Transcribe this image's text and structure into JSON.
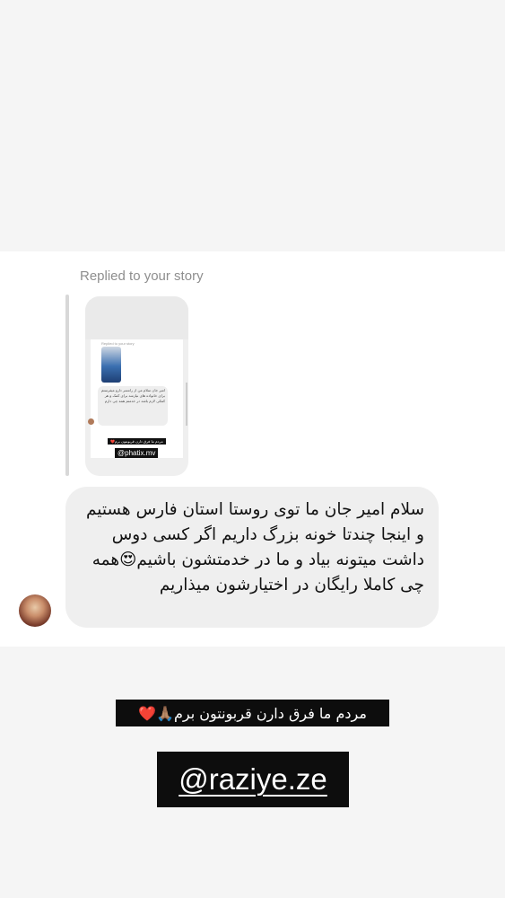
{
  "story_reply": {
    "label": "Replied to your story",
    "thumbnail": {
      "mini_label": "Replied to your story",
      "mini_message": "امیر جان سلام من از رامسر دارو میفرستم برای خانواده های نیازمند برای کمک و هر کمکی لازم باشد در خدمتم همه چی دارم",
      "mini_sticker_caption": "مردم ما فرق دارن قربونتون برم❤️",
      "mini_mention": "@phatix.mv"
    }
  },
  "message": {
    "text": "سلام امیر جان ما توی روستا استان فارس هستیم و اینجا چندتا خونه بزرگ داریم اگر کسی دوس داشت میتونه بیاد و ما در خدمتشون باشیم😍همه چی کاملا رایگان در اختیارشون میذاریم"
  },
  "sticker": {
    "caption": "مردم ما فرق دارن قربونتون برم🙏🏽❤️"
  },
  "mention": {
    "handle": "@raziye.ze"
  }
}
